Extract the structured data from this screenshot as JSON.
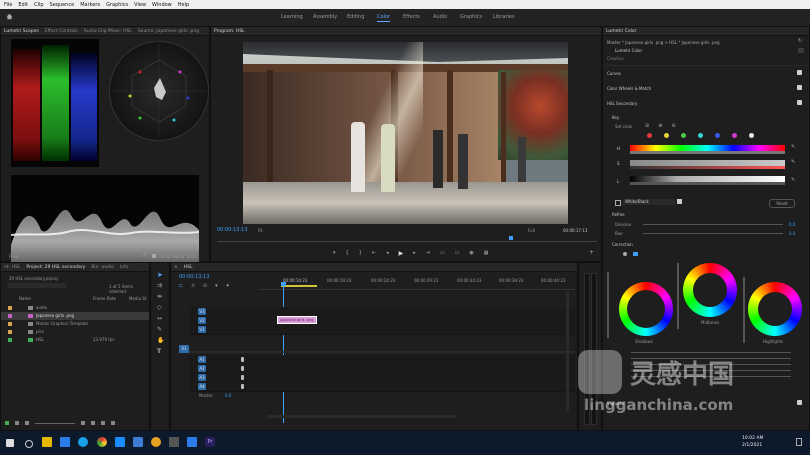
{
  "menubar": {
    "items": [
      "File",
      "Edit",
      "Clip",
      "Sequence",
      "Markers",
      "Graphics",
      "View",
      "Window",
      "Help"
    ]
  },
  "workspaces": {
    "tabs": [
      "Learning",
      "Assembly",
      "Editing",
      "Color",
      "Effects",
      "Audio",
      "Graphics",
      "Libraries"
    ],
    "active": "Color"
  },
  "source_panel": {
    "tabs": [
      "Lumetri Scopes",
      "Effect Controls",
      "Audio Clip Mixer: HSL",
      "Source: Japanese girls .png"
    ],
    "footer_left": "Float",
    "footer_clamp": "Clamp Signal",
    "footer_bit": "8 Bit"
  },
  "program_panel": {
    "title": "Program: HSL",
    "timecode_left": "00:00:13:13",
    "fit": "Fit",
    "full": "Full",
    "timecode_right": "00:00:17:13"
  },
  "project_panel": {
    "tabs": [
      "nt: HSL",
      "Project: 29 HSL secondary",
      "Bin: audio",
      "Info"
    ],
    "subtitle": "29 HSL secondary.prproj",
    "selection_info": "1 of 5 items selected",
    "col_name": "Name",
    "col_fps": "Frame Rate",
    "col_media": "Media St",
    "items": [
      {
        "name": "audio",
        "fps": "",
        "color": "#d9a54a"
      },
      {
        "name": "Japanese girls .png",
        "fps": "",
        "color": "#c561c5"
      },
      {
        "name": "Motion Graphics Template",
        "fps": "",
        "color": "#d9a54a"
      },
      {
        "name": "pics",
        "fps": "",
        "color": "#d9a54a"
      },
      {
        "name": "HSL",
        "fps": "23.976 fps",
        "color": "#3fae5a"
      }
    ]
  },
  "timeline": {
    "tab": "HSL",
    "timecode": "00:00:13:13",
    "ruler": [
      "00:00:14:23",
      "00:00:19:23",
      "00:00:24:23",
      "00:00:29:23",
      "00:00:34:23",
      "00:00:39:23",
      "00:00:44:23"
    ],
    "clip_label": "Japanese girls .png",
    "video_tracks": [
      "V3",
      "V2",
      "V1"
    ],
    "audio_tracks": [
      "A1",
      "A2",
      "A3",
      "A4"
    ],
    "master_label": "Master",
    "master_value": "0.0"
  },
  "lumetri": {
    "panel_title": "Lumetri Color",
    "breadcrumb": "Master * Japanese girls .png  >  HSL * Japanese girls .png",
    "effect_name": "Lumetri Color",
    "creative": "Creative",
    "curves": "Curves",
    "color_wheels": "Color Wheels & Match",
    "hsl_secondary": "HSL Secondary",
    "key": "Key",
    "set_color": "Set color",
    "h": "H",
    "s": "S",
    "l": "L",
    "white_black": "White/Black",
    "reset": "Reset",
    "refine": "Refine",
    "denoise": "Denoise",
    "blur": "Blur",
    "denoise_val": "0.0",
    "blur_val": "0.0",
    "correction": "Correction",
    "shadows": "Shadows",
    "midtones": "Midtones",
    "highlights": "Highlights",
    "vignette": "Vignette",
    "swatches": [
      "#e23a3a",
      "#e8d23a",
      "#4bc94b",
      "#3ad2d2",
      "#3a5ae8",
      "#d23ad2",
      "#e8e8e8"
    ]
  },
  "taskbar": {
    "time": "10:02 AM",
    "date": "2/1/2021"
  },
  "watermark": {
    "cn_text": "灵感中国",
    "url": "lingganchina.com"
  }
}
